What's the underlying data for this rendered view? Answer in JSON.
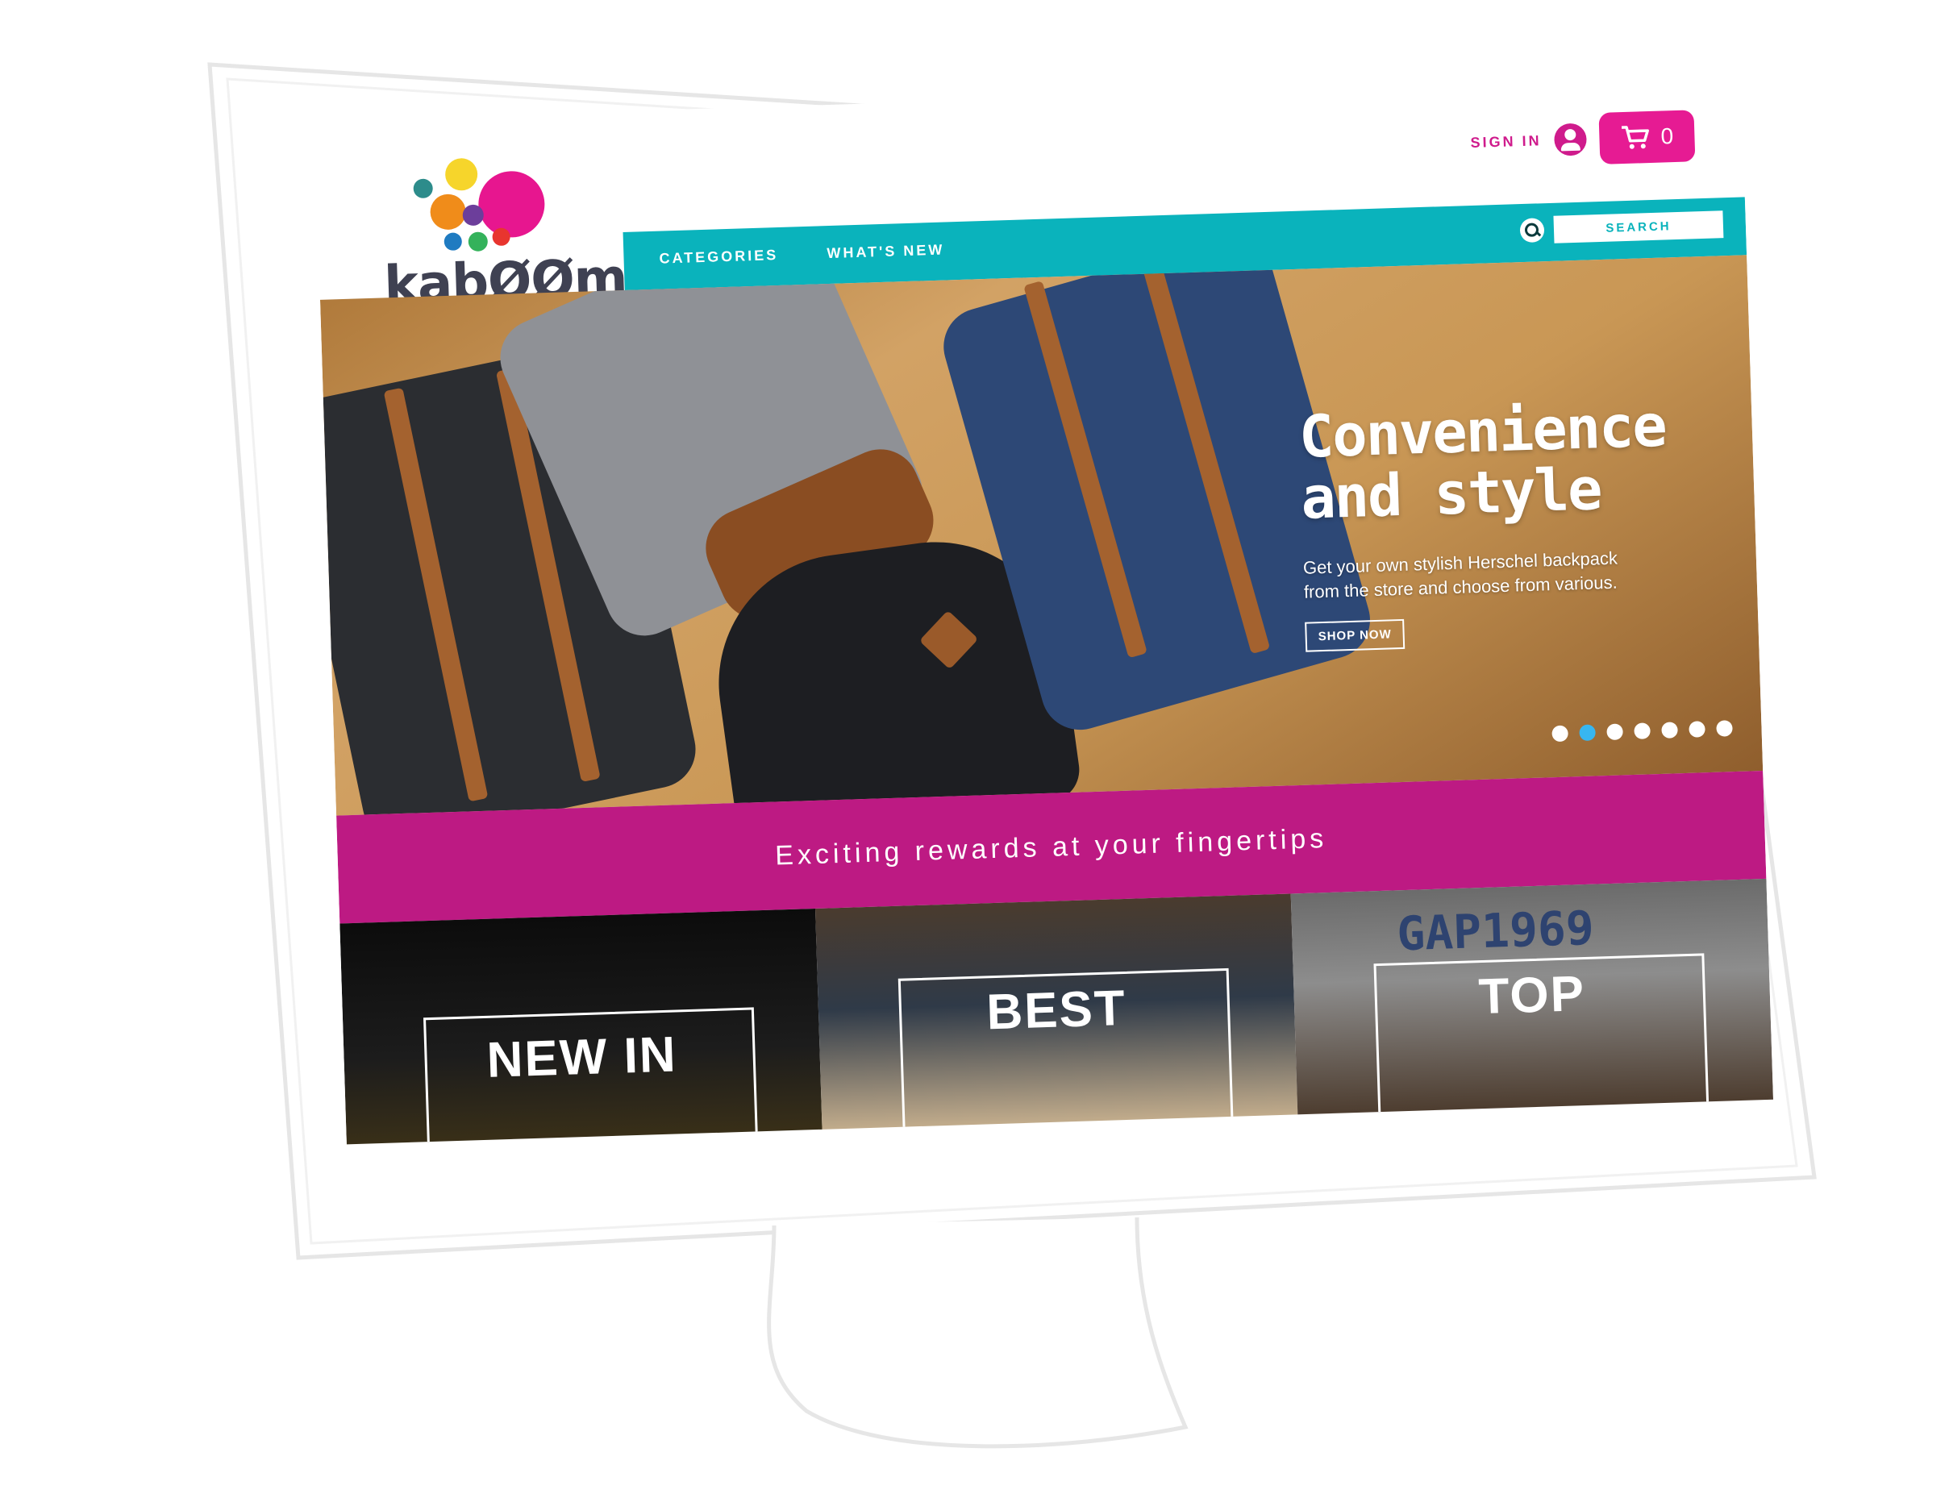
{
  "header": {
    "logo_text": "kabØØm",
    "signin_label": "SIGN IN",
    "cart_count": "0"
  },
  "nav": {
    "items": [
      {
        "label": "CATEGORIES"
      },
      {
        "label": "WHAT'S NEW"
      }
    ],
    "search_placeholder": "SEARCH"
  },
  "hero": {
    "title_line1": "Convenience",
    "title_line2": "and style",
    "subtitle_line1": "Get your own stylish Herschel backpack",
    "subtitle_line2": "from the store and choose from various.",
    "cta_label": "SHOP NOW",
    "slide_count": 7,
    "active_slide": 2
  },
  "rewards": {
    "text": "Exciting rewards at your fingertips"
  },
  "tiles": [
    {
      "label": "NEW IN"
    },
    {
      "label": "BEST"
    },
    {
      "label": "TOP",
      "print_text": "GAP1969"
    }
  ],
  "colors": {
    "brand_pink": "#e61b93",
    "brand_teal": "#0ab3bc",
    "rewards_magenta": "#bd1a83",
    "active_dot": "#37b6f0"
  },
  "icons": [
    "user-icon",
    "cart-icon",
    "search-icon"
  ]
}
